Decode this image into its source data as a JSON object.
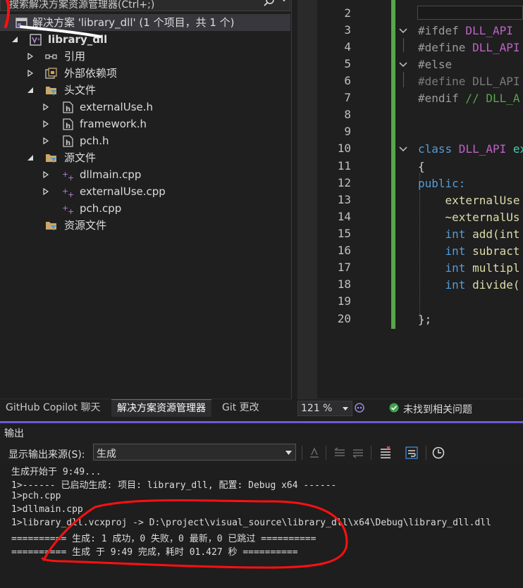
{
  "solution_explorer": {
    "search_placeholder": "搜索解决方案资源管理器(Ctrl+;)",
    "solution_label": "解决方案 'library_dll' (1 个项目，共 1 个)",
    "project": "library_dll",
    "items": [
      {
        "label": "引用",
        "icon": "references-icon"
      },
      {
        "label": "外部依赖项",
        "icon": "external-deps-icon"
      },
      {
        "label": "头文件",
        "icon": "filter-folder-icon"
      },
      {
        "label": "externalUse.h",
        "icon": "header-file-icon"
      },
      {
        "label": "framework.h",
        "icon": "header-file-icon"
      },
      {
        "label": "pch.h",
        "icon": "header-file-icon"
      },
      {
        "label": "源文件",
        "icon": "filter-folder-icon"
      },
      {
        "label": "dllmain.cpp",
        "icon": "cpp-file-icon"
      },
      {
        "label": "externalUse.cpp",
        "icon": "cpp-file-icon"
      },
      {
        "label": "pch.cpp",
        "icon": "cpp-file-icon"
      },
      {
        "label": "资源文件",
        "icon": "filter-folder-icon"
      }
    ]
  },
  "bottom_tabs": [
    "GitHub Copilot 聊天",
    "解决方案资源管理器",
    "Git 更改"
  ],
  "editor": {
    "line_numbers": [
      "2",
      "3",
      "4",
      "5",
      "6",
      "7",
      "8",
      "9",
      "10",
      "11",
      "12",
      "13",
      "14",
      "15",
      "16",
      "17",
      "18",
      "19",
      "20"
    ],
    "lines": {
      "l3a": "#ifdef",
      "l3b": " DLL_API",
      "l4a": "#define",
      "l4b": " DLL_API",
      "l5": "#else",
      "l6a": "#define",
      "l6b": " DLL_API",
      "l7a": "#endif",
      "l7b": " // DLL_A",
      "l10a": "class",
      "l10b": " DLL_API",
      "l10c": " ex",
      "l11": "{",
      "l12": "public:",
      "l13": "    externalUse",
      "l14": "    ~externalUs",
      "l15a": "    int",
      "l15b": " add(int",
      "l16a": "    int",
      "l16b": " subract",
      "l17a": "    int",
      "l17b": " multipl",
      "l18a": "    int",
      "l18b": " divide(",
      "l20": "};"
    }
  },
  "status": {
    "zoom": "121 %",
    "issues": "未找到相关问题"
  },
  "output": {
    "title": "输出",
    "source_label": "显示输出来源(S):",
    "source_value": "生成",
    "lines": [
      "生成开始于 9:49...",
      "1>------ 已启动生成: 项目: library_dll, 配置: Debug x64 ------",
      "1>pch.cpp",
      "1>dllmain.cpp",
      "1>library_dll.vcxproj -> D:\\project\\visual_source\\library_dll\\x64\\Debug\\library_dll.dll",
      "========== 生成: 1 成功，0 失败，0 最新，0 已跳过 ==========",
      "========== 生成 于 9:49 完成，耗时 01.427 秒 =========="
    ]
  },
  "colors": {
    "accent": "#6b5bd6",
    "change_bar": "#57a64a",
    "annotation": "#ff0000"
  }
}
